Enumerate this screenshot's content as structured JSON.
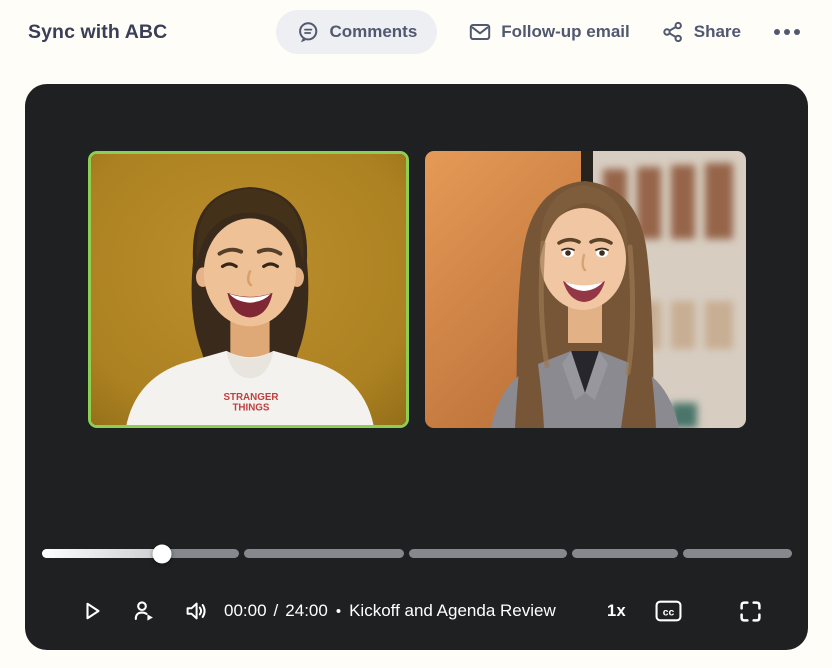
{
  "header": {
    "title": "Sync with ABC",
    "comments_label": "Comments",
    "email_label": "Follow-up email",
    "share_label": "Share",
    "more_label": "•••"
  },
  "icons": {
    "comments": "speech-bubble-icon",
    "email": "envelope-icon",
    "share": "share-nodes-icon",
    "more": "ellipsis-icon",
    "play": "play-icon",
    "speaker_skip": "person-play-icon",
    "volume": "speaker-waves-icon",
    "captions": "closed-captions-icon",
    "fullscreen": "fullscreen-corners-icon"
  },
  "player": {
    "tiles": [
      {
        "role": "active speaker",
        "highlighted": true,
        "background_color": "#b2851f",
        "border_color": "#8ccf52",
        "shirt_text_line1": "STRANGER",
        "shirt_text_line2": "THINGS"
      },
      {
        "role": "participant",
        "highlighted": false,
        "background_color": "#df9251"
      }
    ],
    "progress": {
      "segments_percent": [
        26.4,
        21.3,
        21.2,
        14.1,
        14.6
      ],
      "current_segment": 0,
      "segment_progress_percent": 61
    },
    "controls": {
      "time_current": "00:00",
      "time_separator": "/",
      "time_total": "24:00",
      "bullet": "•",
      "chapter_title": "Kickoff and Agenda Review",
      "speed_label": "1x",
      "cc_label": "cc"
    }
  },
  "colors": {
    "page_background": "#fffdf8",
    "panel_background": "#1e2022",
    "title_text": "#3a3f58",
    "action_text": "#515870",
    "pill_background": "#edeff2",
    "active_border": "#8ccf52",
    "track_color": "#85888c",
    "thumb_color": "#ffffff",
    "control_icon": "#ffffff"
  }
}
